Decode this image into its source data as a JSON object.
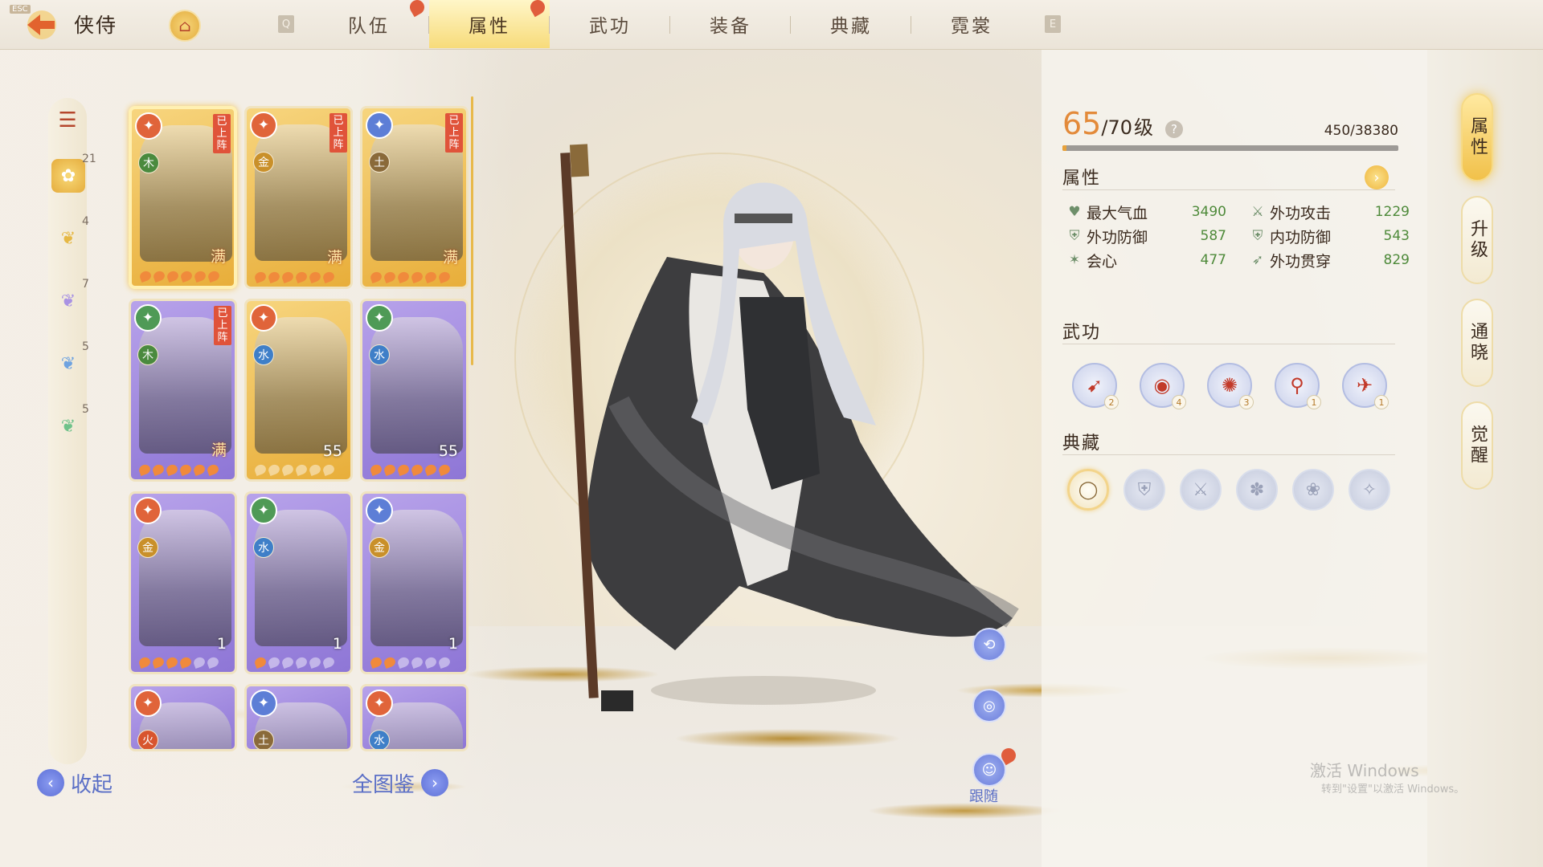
{
  "topbar": {
    "esc_label": "ESC",
    "title": "侠侍",
    "key_q": "Q",
    "key_e": "E",
    "tabs": [
      {
        "label": "队伍",
        "active": false,
        "notice": true
      },
      {
        "label": "属性",
        "active": true,
        "notice": true
      },
      {
        "label": "武功",
        "active": false,
        "notice": false
      },
      {
        "label": "装备",
        "active": false,
        "notice": false
      },
      {
        "label": "典藏",
        "active": false,
        "notice": false
      },
      {
        "label": "霓裳",
        "active": false,
        "notice": false
      }
    ]
  },
  "filters": {
    "counts": [
      "21",
      "4",
      "7",
      "5",
      "5"
    ]
  },
  "cards": [
    {
      "elem": "木",
      "faction_color": "#e0643a",
      "rarity": "gold",
      "deployed": "已上阵",
      "level": "满",
      "stars": 6,
      "selected": true
    },
    {
      "elem": "金",
      "faction_color": "#e0643a",
      "rarity": "gold",
      "deployed": "已上阵",
      "level": "满",
      "stars": 6,
      "selected": false
    },
    {
      "elem": "土",
      "faction_color": "#5d7ed6",
      "rarity": "gold",
      "deployed": "已上阵",
      "level": "满",
      "stars": 6,
      "selected": false
    },
    {
      "elem": "木",
      "faction_color": "#4f9a56",
      "rarity": "purple",
      "deployed": "已上阵",
      "level": "满",
      "stars": 6,
      "selected": false
    },
    {
      "elem": "水",
      "faction_color": "#e0643a",
      "rarity": "gold",
      "deployed": "",
      "level": "55",
      "stars": 0,
      "selected": false
    },
    {
      "elem": "水",
      "faction_color": "#4f9a56",
      "rarity": "purple",
      "deployed": "",
      "level": "55",
      "stars": 6,
      "selected": false
    },
    {
      "elem": "金",
      "faction_color": "#e0643a",
      "rarity": "purple",
      "deployed": "",
      "level": "1",
      "stars": 4,
      "selected": false
    },
    {
      "elem": "水",
      "faction_color": "#4f9a56",
      "rarity": "purple",
      "deployed": "",
      "level": "1",
      "stars": 1,
      "selected": false
    },
    {
      "elem": "金",
      "faction_color": "#5d7ed6",
      "rarity": "purple",
      "deployed": "",
      "level": "1",
      "stars": 2,
      "selected": false
    },
    {
      "elem": "火",
      "faction_color": "#e0643a",
      "rarity": "purple",
      "deployed": "",
      "level": "",
      "stars": 0,
      "selected": false
    },
    {
      "elem": "土",
      "faction_color": "#5d7ed6",
      "rarity": "purple",
      "deployed": "",
      "level": "",
      "stars": 0,
      "selected": false
    },
    {
      "elem": "水",
      "faction_color": "#e0643a",
      "rarity": "purple",
      "deployed": "",
      "level": "",
      "stars": 0,
      "selected": false
    }
  ],
  "bottom_left": {
    "collapse": "收起",
    "atlas": "全图鉴"
  },
  "character_actions": {
    "follow": "跟随"
  },
  "info": {
    "level_current": "65",
    "level_max": "/70",
    "level_unit": "级",
    "exp_text": "450/38380",
    "exp_fraction": 0.0117,
    "attr_title": "属性",
    "stats": [
      {
        "name": "最大气血",
        "value": "3490",
        "icon": "heart-icon"
      },
      {
        "name": "外功攻击",
        "value": "1229",
        "icon": "sword-icon"
      },
      {
        "name": "外功防御",
        "value": "587",
        "icon": "armor-icon"
      },
      {
        "name": "内功防御",
        "value": "543",
        "icon": "armor-icon"
      },
      {
        "name": "会心",
        "value": "477",
        "icon": "crit-icon"
      },
      {
        "name": "外功贯穿",
        "value": "829",
        "icon": "pierce-icon"
      }
    ],
    "skills_title": "武功",
    "skills": [
      "2",
      "4",
      "3",
      "1",
      "1"
    ],
    "relics_title": "典藏"
  },
  "vtabs": [
    {
      "label": "属性",
      "active": true
    },
    {
      "label": "升级",
      "active": false
    },
    {
      "label": "通晓",
      "active": false
    },
    {
      "label": "觉醒",
      "active": false
    }
  ],
  "watermark": {
    "line1": "激活 Windows",
    "line2": "转到\"设置\"以激活 Windows。"
  }
}
